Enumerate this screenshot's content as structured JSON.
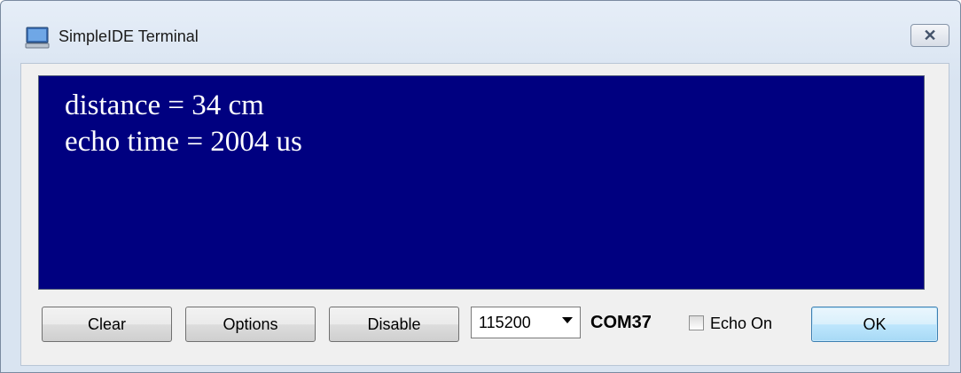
{
  "window": {
    "title": "SimpleIDE Terminal",
    "icon": "terminal-monitor-icon",
    "close_glyph": "✕"
  },
  "terminal": {
    "background": "#000080",
    "text_color": "#ffffff",
    "lines": [
      "distance = 34 cm",
      "echo time = 2004 us"
    ]
  },
  "toolbar": {
    "clear_label": "Clear",
    "options_label": "Options",
    "disable_label": "Disable",
    "baud_rate": "115200",
    "port_label": "COM37",
    "echo_label": "Echo On",
    "echo_checked": false,
    "ok_label": "OK"
  }
}
